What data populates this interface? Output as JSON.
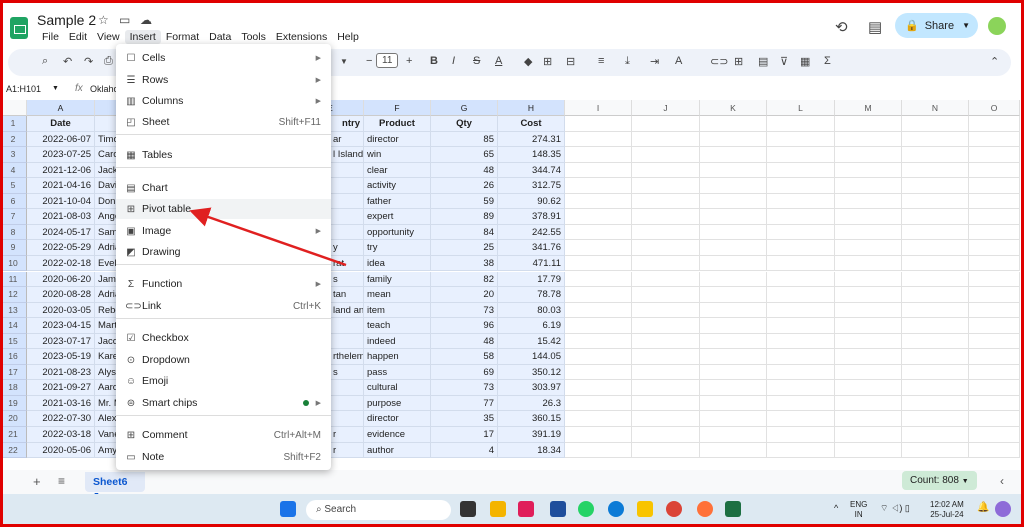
{
  "app": {
    "title": "Sample 2",
    "menus": [
      "File",
      "Edit",
      "View",
      "Insert",
      "Format",
      "Data",
      "Tools",
      "Extensions",
      "Help"
    ],
    "active_menu": "Insert",
    "share_label": "Share"
  },
  "toolbar": {
    "font_size": "11"
  },
  "formula_bar": {
    "name_box": "A1:H101",
    "fx": "fx",
    "value": "Oklaho"
  },
  "columns": [
    "A",
    "B",
    "C",
    "D",
    "E",
    "F",
    "G",
    "H",
    "I",
    "J",
    "K",
    "L",
    "M",
    "N",
    "O"
  ],
  "headers": {
    "A": "Date",
    "E": "ntry",
    "F": "Product",
    "G": "Qty",
    "H": "Cost"
  },
  "rows": [
    [
      "2022-06-07",
      "Timo",
      "ar",
      "director",
      "85",
      "274.31"
    ],
    [
      "2023-07-25",
      "Carol",
      "l Islands",
      "win",
      "65",
      "148.35"
    ],
    [
      "2021-12-06",
      "Jack",
      "",
      "clear",
      "48",
      "344.74"
    ],
    [
      "2021-04-16",
      "David",
      "",
      "activity",
      "26",
      "312.75"
    ],
    [
      "2021-10-04",
      "Donn",
      "",
      "father",
      "59",
      "90.62"
    ],
    [
      "2021-08-03",
      "Ange",
      "",
      "expert",
      "89",
      "378.91"
    ],
    [
      "2024-05-17",
      "Sama",
      "",
      "opportunity",
      "84",
      "242.55"
    ],
    [
      "2022-05-29",
      "Adria",
      "y",
      "try",
      "25",
      "341.76"
    ],
    [
      "2022-02-18",
      "Evely",
      "rat",
      "idea",
      "38",
      "471.11"
    ],
    [
      "2020-06-20",
      "Jame",
      "s",
      "family",
      "82",
      "17.79"
    ],
    [
      "2020-08-28",
      "Adria",
      "tan",
      "mean",
      "20",
      "78.78"
    ],
    [
      "2020-03-05",
      "Rebe",
      "land anc",
      "item",
      "73",
      "80.03"
    ],
    [
      "2023-04-15",
      "Mart",
      "",
      "teach",
      "96",
      "6.19"
    ],
    [
      "2023-07-17",
      "Jacob",
      "",
      "indeed",
      "48",
      "15.42"
    ],
    [
      "2023-05-19",
      "Karen",
      "rthelem",
      "happen",
      "58",
      "144.05"
    ],
    [
      "2021-08-23",
      "Alyss",
      "s",
      "pass",
      "69",
      "350.12"
    ],
    [
      "2021-09-27",
      "Aaro",
      "",
      "cultural",
      "73",
      "303.97"
    ],
    [
      "2021-03-16",
      "Mr. M",
      "",
      "purpose",
      "77",
      "26.3"
    ],
    [
      "2022-07-30",
      "Alexi",
      "",
      "director",
      "35",
      "360.15"
    ],
    [
      "2022-03-18",
      "Vane",
      "r",
      "evidence",
      "17",
      "391.19"
    ],
    [
      "2020-05-06",
      "Amy",
      "r",
      "author",
      "4",
      "18.34"
    ]
  ],
  "insert_menu": [
    {
      "label": "Cells",
      "icon": "cells-icon",
      "glyph": "☐",
      "submenu": true
    },
    {
      "label": "Rows",
      "icon": "rows-icon",
      "glyph": "☰",
      "submenu": true
    },
    {
      "label": "Columns",
      "icon": "columns-icon",
      "glyph": "▥",
      "submenu": true
    },
    {
      "label": "Sheet",
      "icon": "sheet-icon",
      "glyph": "◰",
      "shortcut": "Shift+F11"
    },
    {
      "label": "Tables",
      "icon": "tables-icon",
      "glyph": "▦"
    },
    {
      "label": "Chart",
      "icon": "chart-icon",
      "glyph": "▤"
    },
    {
      "label": "Pivot table",
      "icon": "pivot-table-icon",
      "glyph": "⊞",
      "highlighted": true
    },
    {
      "label": "Image",
      "icon": "image-icon",
      "glyph": "▣",
      "submenu": true
    },
    {
      "label": "Drawing",
      "icon": "drawing-icon",
      "glyph": "◩"
    },
    {
      "label": "Function",
      "icon": "function-icon",
      "glyph": "Σ",
      "submenu": true
    },
    {
      "label": "Link",
      "icon": "link-icon",
      "glyph": "⊂⊃",
      "shortcut": "Ctrl+K"
    },
    {
      "label": "Checkbox",
      "icon": "checkbox-icon",
      "glyph": "☑"
    },
    {
      "label": "Dropdown",
      "icon": "dropdown-icon",
      "glyph": "⊙"
    },
    {
      "label": "Emoji",
      "icon": "emoji-icon",
      "glyph": "☺"
    },
    {
      "label": "Smart chips",
      "icon": "smart-chips-icon",
      "glyph": "⊜",
      "submenu": true,
      "dot": true
    },
    {
      "label": "Comment",
      "icon": "comment-icon",
      "glyph": "⊞",
      "shortcut": "Ctrl+Alt+M"
    },
    {
      "label": "Note",
      "icon": "note-icon",
      "glyph": "▭",
      "shortcut": "Shift+F2"
    }
  ],
  "sheet_tab": "Sheet6",
  "status": {
    "count": "Count: 808"
  },
  "taskbar": {
    "search": "Search",
    "lang1": "ENG",
    "lang2": "IN",
    "time": "12:02 AM",
    "date": "25-Jul-24"
  },
  "colors": {
    "accent": "#c2e7ff",
    "selection": "#e8f0fe",
    "arrow": "#e02020"
  }
}
